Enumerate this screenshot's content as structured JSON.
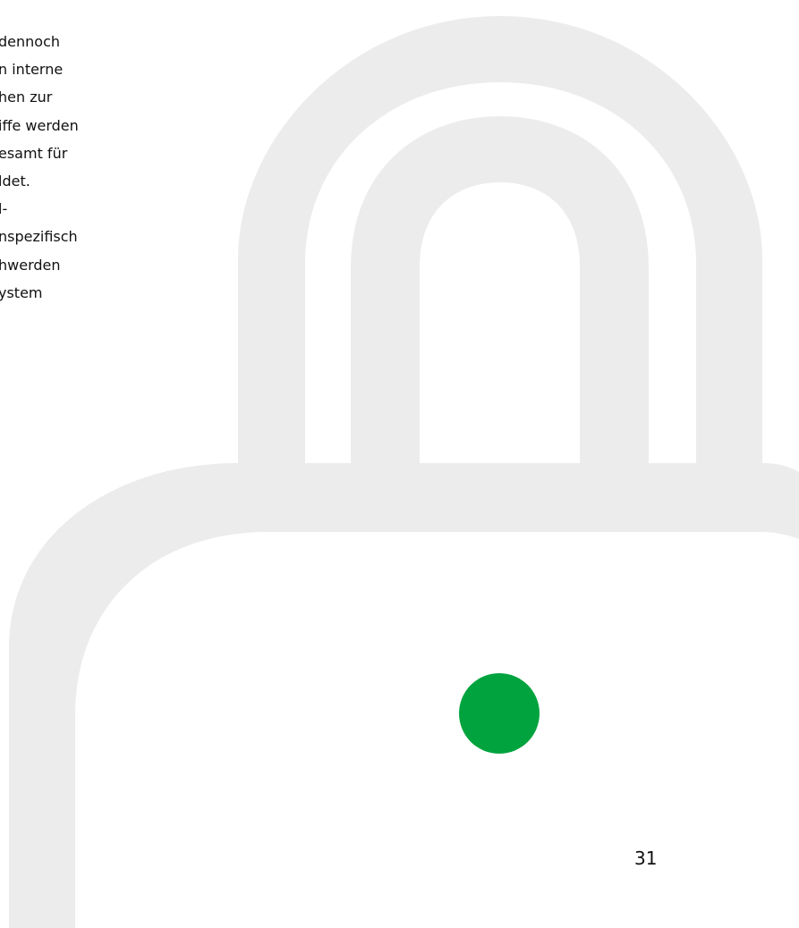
{
  "document": {
    "text_lines_top": [
      "dennoch",
      "n interne",
      "hen zur",
      "iffe werden",
      "esamt für",
      "ldet."
    ],
    "text_lines_bottom": [
      "l-",
      "nspezifisch",
      "hwerden",
      "ystem"
    ],
    "page_number": "31"
  },
  "colors": {
    "lock_gray": "#ececec",
    "indicator_green": "#00a33d",
    "text": "#111111"
  },
  "icons": {
    "background_graphic": "padlock-icon",
    "status_marker": "green-dot-icon"
  }
}
